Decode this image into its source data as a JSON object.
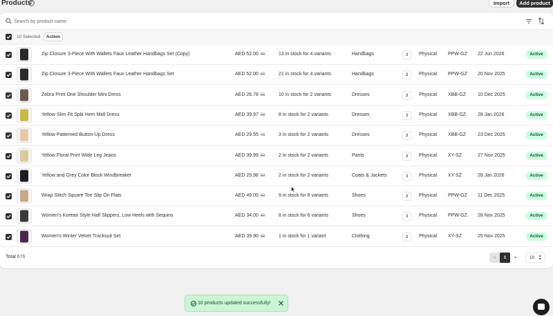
{
  "header": {
    "title": "Products",
    "help_glyph": "?",
    "import_label": "Import",
    "add_label": "Add product"
  },
  "search": {
    "placeholder": "Search by product name",
    "value": ""
  },
  "bulk": {
    "selected_text": "10 Selected",
    "action_label": "Action"
  },
  "rows": [
    {
      "name": "Zip Closure 3-Piece With Wallets Faux Leather Handbags Set (Copy)",
      "price": "AED 52.00",
      "old_price": "69",
      "stock": "13 in stock for 4 variants",
      "category": "Handbags",
      "qty": "3",
      "type": "Physical",
      "vendor": "PPW-GZ",
      "date": "22 Jun 2026",
      "status": "Active",
      "thumb_color": "#2a2a2a"
    },
    {
      "name": "Zip Closure 3-Piece With Wallets Faux Leather Handbags Set",
      "price": "AED 52.00",
      "old_price": "69",
      "stock": "21 in stock for 4 variants",
      "category": "Handbags",
      "qty": "3",
      "type": "Physical",
      "vendor": "PPW-GZ",
      "date": "20 Nov 2025",
      "status": "Active",
      "thumb_color": "#2a2a2a"
    },
    {
      "name": "Zebra Print One Shoulder Mini Dress",
      "price": "AED 26.78",
      "old_price": "55",
      "stock": "10 in stock for 2 variants",
      "category": "Dresses",
      "qty": "3",
      "type": "Physical",
      "vendor": "XBB-GZ",
      "date": "10 Dec 2025",
      "status": "Active",
      "thumb_color": "#6b5a4e"
    },
    {
      "name": "Yellow Slim Fit Split Hem Midi Dress",
      "price": "AED 39.97",
      "old_price": "59",
      "stock": "8 in stock for 2 variants",
      "category": "Dresses",
      "qty": "3",
      "type": "Physical",
      "vendor": "XBB-GZ",
      "date": "28 Jan 2026",
      "status": "Active",
      "thumb_color": "#c8b84a"
    },
    {
      "name": "Yellow Patterned Button-Up Dress",
      "price": "AED 29.55",
      "old_price": "49",
      "stock": "3 in stock for 2 variants",
      "category": "Dresses",
      "qty": "3",
      "type": "Physical",
      "vendor": "XBB-GZ",
      "date": "23 Dec 2025",
      "status": "Active",
      "thumb_color": "#e6c9a8"
    },
    {
      "name": "Yellow Floral Print Wide Leg Jeans",
      "price": "AED 39.99",
      "old_price": "59",
      "stock": "2 in stock for 2 variants",
      "category": "Pants",
      "qty": "3",
      "type": "Physical",
      "vendor": "XY-SZ",
      "date": "27 Nov 2025",
      "status": "Active",
      "thumb_color": "#d9cba0"
    },
    {
      "name": "Yellow and Grey Color Block Windbreaker",
      "price": "AED 29.98",
      "old_price": "59",
      "stock": "2 in stock for 2 variants",
      "category": "Coats & Jackets",
      "qty": "3",
      "type": "Physical",
      "vendor": "XY-SZ",
      "date": "28 Jan 2026",
      "status": "Active",
      "thumb_color": "#1f1f1f"
    },
    {
      "name": "Wrap Stitch Square Toe Slip On Flats",
      "price": "AED 49.00",
      "old_price": "59",
      "stock": "9 in stock for 6 variants",
      "category": "Shoes",
      "qty": "3",
      "type": "Physical",
      "vendor": "PPW-GZ",
      "date": "11 Dec 2025",
      "status": "Active",
      "thumb_color": "#c9a98a"
    },
    {
      "name": "Women's Korean Style Half Slippers, Low Heels with Sequins",
      "price": "AED 34.00",
      "old_price": "60",
      "stock": "8 in stock for 6 variants",
      "category": "Shoes",
      "qty": "3",
      "type": "Physical",
      "vendor": "PPW-GZ",
      "date": "28 Nov 2025",
      "status": "Active",
      "thumb_color": "#3a3a3a"
    },
    {
      "name": "Women's Winter Velvet Tracksuit Set",
      "price": "AED 39.90",
      "old_price": "65",
      "stock": "1 in stock for 1 variant",
      "category": "Clothing",
      "qty": "3",
      "type": "Physical",
      "vendor": "XY-SZ",
      "date": "25 Nov 2025",
      "status": "Active",
      "thumb_color": "#4a2a4a"
    }
  ],
  "footer": {
    "total_label": "Total",
    "total_value": "676",
    "prev": "<",
    "current_page": "1",
    "next": ">",
    "page_size": "10"
  },
  "toast": {
    "message": "10 products updated successfully!"
  },
  "colors": {
    "status_bg": "#cdfee1",
    "status_text": "#0c5132",
    "primary": "#303030",
    "toast_bg": "#cdf4d6"
  }
}
